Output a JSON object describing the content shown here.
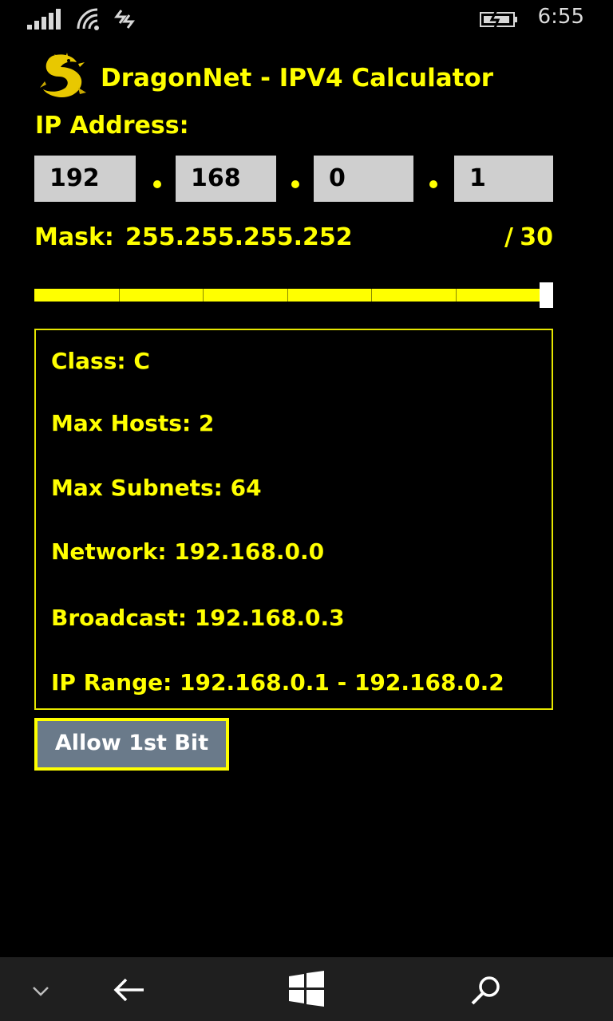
{
  "status_bar": {
    "time": "6:55",
    "icons": [
      "signal-icon",
      "wifi-icon",
      "data-icon",
      "battery-icon"
    ]
  },
  "header": {
    "logo_icon": "dragon-logo-icon",
    "title": "DragonNet - IPV4 Calculator"
  },
  "ip_address": {
    "label": "IP Address:",
    "octets": [
      "192",
      "168",
      "0",
      "1"
    ]
  },
  "mask": {
    "prefix": "Mask:",
    "value": "255.255.255.252",
    "cidr_slash": "/",
    "cidr_value": "30"
  },
  "slider": {
    "value_fraction": 1.0,
    "tick_count": 6
  },
  "results": {
    "class": "Class: C",
    "max_hosts": "Max Hosts: 2",
    "max_subnets": "Max Subnets: 64",
    "network": "Network: 192.168.0.0",
    "broadcast": "Broadcast: 192.168.0.3",
    "ip_range": "IP Range: 192.168.0.1 - 192.168.0.2"
  },
  "allow_button": {
    "label": "Allow 1st Bit"
  },
  "nav_bar": {
    "icons": [
      "chevron-down-icon",
      "back-arrow-icon",
      "windows-start-icon",
      "search-icon"
    ]
  },
  "colors": {
    "accent": "#ffff00",
    "background": "#000000",
    "input_bg": "#cfcfcf",
    "button_bg": "#6a7a8a",
    "nav_bg": "#1f1f1f"
  }
}
